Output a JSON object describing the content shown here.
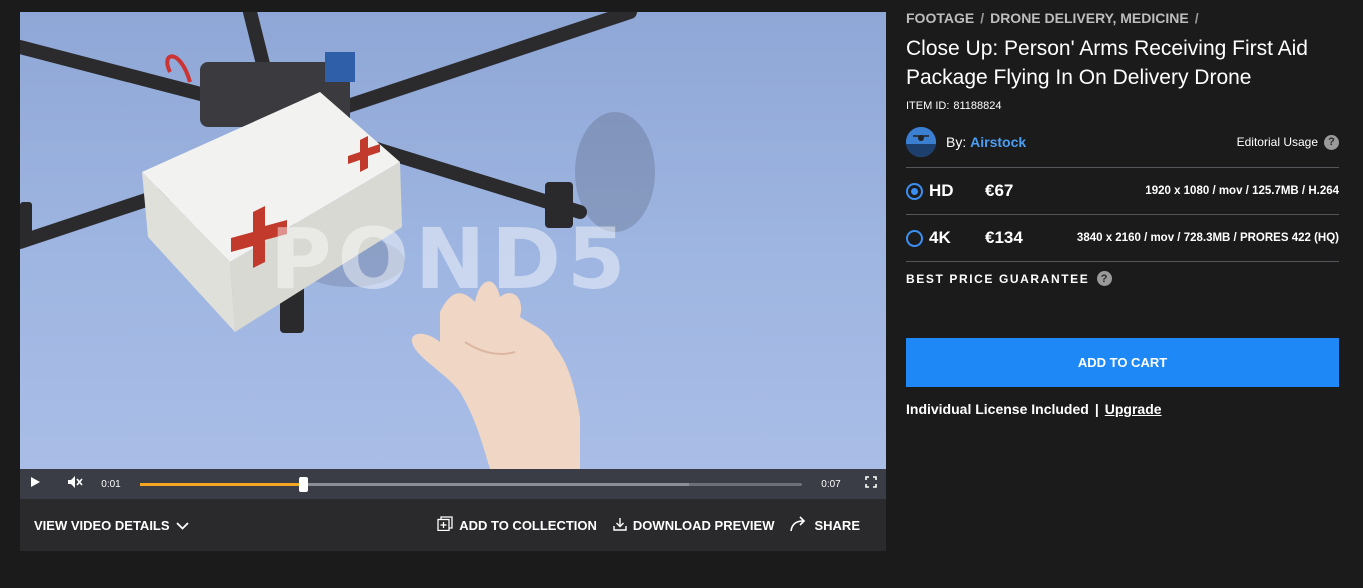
{
  "player": {
    "watermark": "POND5",
    "current_time": "0:01",
    "duration": "0:07",
    "progress_fraction": 0.246,
    "buffered_fraction": 0.83,
    "icons": {
      "play": "play-icon",
      "mute": "muted-speaker-icon",
      "fullscreen": "fullscreen-icon"
    }
  },
  "actions": {
    "view_details": "VIEW VIDEO DETAILS",
    "add_to_collection": "ADD TO COLLECTION",
    "download_preview": "DOWNLOAD PREVIEW",
    "share": "SHARE"
  },
  "breadcrumb": {
    "items": [
      "FOOTAGE",
      "DRONE DELIVERY, MEDICINE"
    ],
    "separator": "/"
  },
  "title": "Close Up: Person' Arms Receiving First Aid Package Flying In On Delivery Drone",
  "item_id": {
    "label": "ITEM ID:",
    "value": "81188824"
  },
  "author": {
    "by_label": "By:",
    "name": "Airstock"
  },
  "usage": {
    "label": "Editorial Usage"
  },
  "options": [
    {
      "res": "HD",
      "price": "€67",
      "spec": "1920 x 1080 / mov / 125.7MB / H.264",
      "selected": true
    },
    {
      "res": "4K",
      "price": "€134",
      "spec": "3840 x 2160 / mov / 728.3MB / PRORES 422 (HQ)",
      "selected": false
    }
  ],
  "guarantee": "BEST PRICE GUARANTEE",
  "help_glyph": "?",
  "cart_label": "ADD TO CART",
  "license": {
    "text": "Individual License Included",
    "separator": "|",
    "upgrade": "Upgrade"
  },
  "colors": {
    "accent": "#1e88f7",
    "progress": "#f5a623",
    "link": "#4a9ff5",
    "background": "#1b1b1c"
  }
}
